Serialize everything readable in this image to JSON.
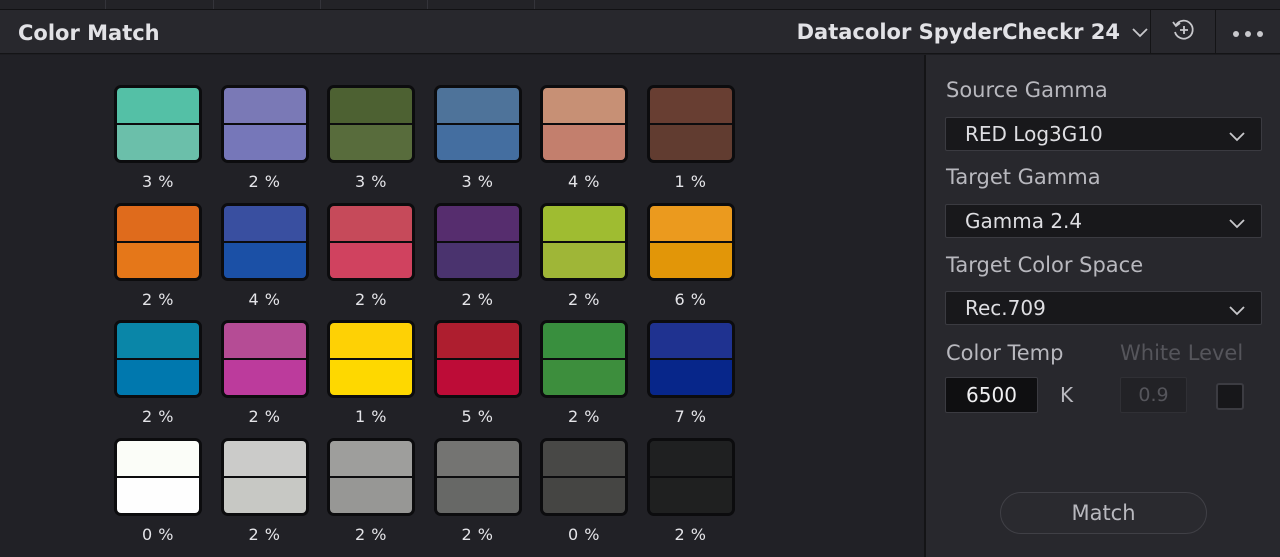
{
  "panel": {
    "title": "Color Match",
    "chart_type": "Datacolor SpyderCheckr 24"
  },
  "header_icons": {
    "dropdown": "chevron-down-icon",
    "reset": "reset-icon",
    "more": "more-options-icon"
  },
  "swatches": [
    {
      "top": "#54c0a6",
      "bottom": "#6bbfaa",
      "percent": "3 %"
    },
    {
      "top": "#7a79b6",
      "bottom": "#7677b9",
      "percent": "2 %"
    },
    {
      "top": "#4d6132",
      "bottom": "#586c3c",
      "percent": "3 %"
    },
    {
      "top": "#4e739a",
      "bottom": "#446ea0",
      "percent": "3 %"
    },
    {
      "top": "#c79075",
      "bottom": "#c37f6d",
      "percent": "4 %"
    },
    {
      "top": "#683e32",
      "bottom": "#613c30",
      "percent": "1 %"
    },
    {
      "top": "#df6b1c",
      "bottom": "#e57719",
      "percent": "2 %"
    },
    {
      "top": "#394fa0",
      "bottom": "#1b50a6",
      "percent": "4 %"
    },
    {
      "top": "#c64a5a",
      "bottom": "#d0425f",
      "percent": "2 %"
    },
    {
      "top": "#562d6e",
      "bottom": "#4a336e",
      "percent": "2 %"
    },
    {
      "top": "#9fbc31",
      "bottom": "#9fb637",
      "percent": "2 %"
    },
    {
      "top": "#eb9a1e",
      "bottom": "#e29608",
      "percent": "6 %"
    },
    {
      "top": "#0a86a8",
      "bottom": "#0078ae",
      "percent": "2 %"
    },
    {
      "top": "#b54c95",
      "bottom": "#bc3b9c",
      "percent": "2 %"
    },
    {
      "top": "#fed105",
      "bottom": "#fed800",
      "percent": "1 %"
    },
    {
      "top": "#ae1e2f",
      "bottom": "#bd0c37",
      "percent": "5 %"
    },
    {
      "top": "#398f3e",
      "bottom": "#3d8e3d",
      "percent": "2 %"
    },
    {
      "top": "#1f3290",
      "bottom": "#07268a",
      "percent": "7 %"
    },
    {
      "top": "#fbfdf8",
      "bottom": "#fefefe",
      "percent": "0 %"
    },
    {
      "top": "#cbcbc9",
      "bottom": "#c7c8c4",
      "percent": "2 %"
    },
    {
      "top": "#9e9e9c",
      "bottom": "#979795",
      "percent": "2 %"
    },
    {
      "top": "#747472",
      "bottom": "#676866",
      "percent": "2 %"
    },
    {
      "top": "#484846",
      "bottom": "#454543",
      "percent": "0 %"
    },
    {
      "top": "#1f2021",
      "bottom": "#1f2020",
      "percent": "2 %"
    }
  ],
  "settings": {
    "source_gamma_label": "Source Gamma",
    "source_gamma_value": "RED Log3G10",
    "target_gamma_label": "Target Gamma",
    "target_gamma_value": "Gamma 2.4",
    "target_color_space_label": "Target Color Space",
    "target_color_space_value": "Rec.709",
    "color_temp_label": "Color Temp",
    "color_temp_value": "6500",
    "color_temp_unit": "K",
    "white_level_label": "White Level",
    "white_level_value": "0.9",
    "white_level_enabled": false,
    "match_label": "Match"
  }
}
